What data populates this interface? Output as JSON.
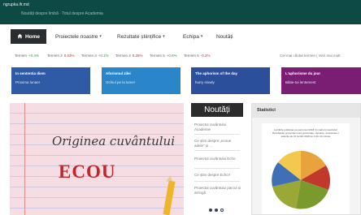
{
  "topbar": {
    "url": "ngrupka.ifr.md",
    "tagline": "Noutăți despre limbă · Totul despre Academia"
  },
  "nav": {
    "home": "Home",
    "items": [
      {
        "label": "Proiectele noastre",
        "dropdown": true
      },
      {
        "label": "Rezultate științifice",
        "dropdown": true
      },
      {
        "label": "Echipa",
        "dropdown": true
      },
      {
        "label": "Noutăți",
        "dropdown": false
      }
    ]
  },
  "rates": {
    "items": [
      {
        "label": "Termen",
        "value": "+0.4%",
        "color": "#2ca02c"
      },
      {
        "label": "Termen 2",
        "value": "0.53%",
        "color": "#d62728"
      },
      {
        "label": "Termen 3",
        "value": "+0.1%",
        "color": "#2ca02c"
      },
      {
        "label": "Termen 4",
        "value": "0.25%",
        "color": "#d62728"
      },
      {
        "label": "Termen 5",
        "value": "+0.6%",
        "color": "#2ca02c"
      },
      {
        "label": "Termen 6",
        "value": "-0.2%",
        "color": "#d62728"
      }
    ],
    "right_note": "Cel mai căutat termen | Vezi mai mult"
  },
  "tiles": [
    {
      "title": "In sententia diem",
      "subtitle": "Proxima lunae!",
      "color": "#2f5aa6"
    },
    {
      "title": "Aforismul zilei",
      "subtitle": "Ochiul pe la lume!",
      "color": "#2a86c9"
    },
    {
      "title": "The aphorism of the day",
      "subtitle": "hurry slowly",
      "color": "#2b4f9a"
    },
    {
      "title": "L'aphorisme du jour",
      "subtitle": "Bâtie-toi lentement",
      "color": "#7a1e74"
    }
  ],
  "hero": {
    "line1": "Originea cuvântului",
    "line2": "ECOU"
  },
  "news": {
    "title": "Noutăți",
    "items": [
      "Proiectul cuvântului Academie",
      "Ce știm despre „ecoue adele” și ...",
      "Proiectul cuvântului Echo",
      "Ce știm despre Echo?",
      "Proiectul cuvântului parcul și arringă"
    ]
  },
  "stats": {
    "title": "Statistici",
    "card_title": "Lucrările publicate pe parcursul 2018 (în cadrul proiectului) Rezultatele proiectului sunt prezentate, rapoarte, ameliorate o selecție de 10 lucrări 2018 pe 3 din 10 minute"
  }
}
